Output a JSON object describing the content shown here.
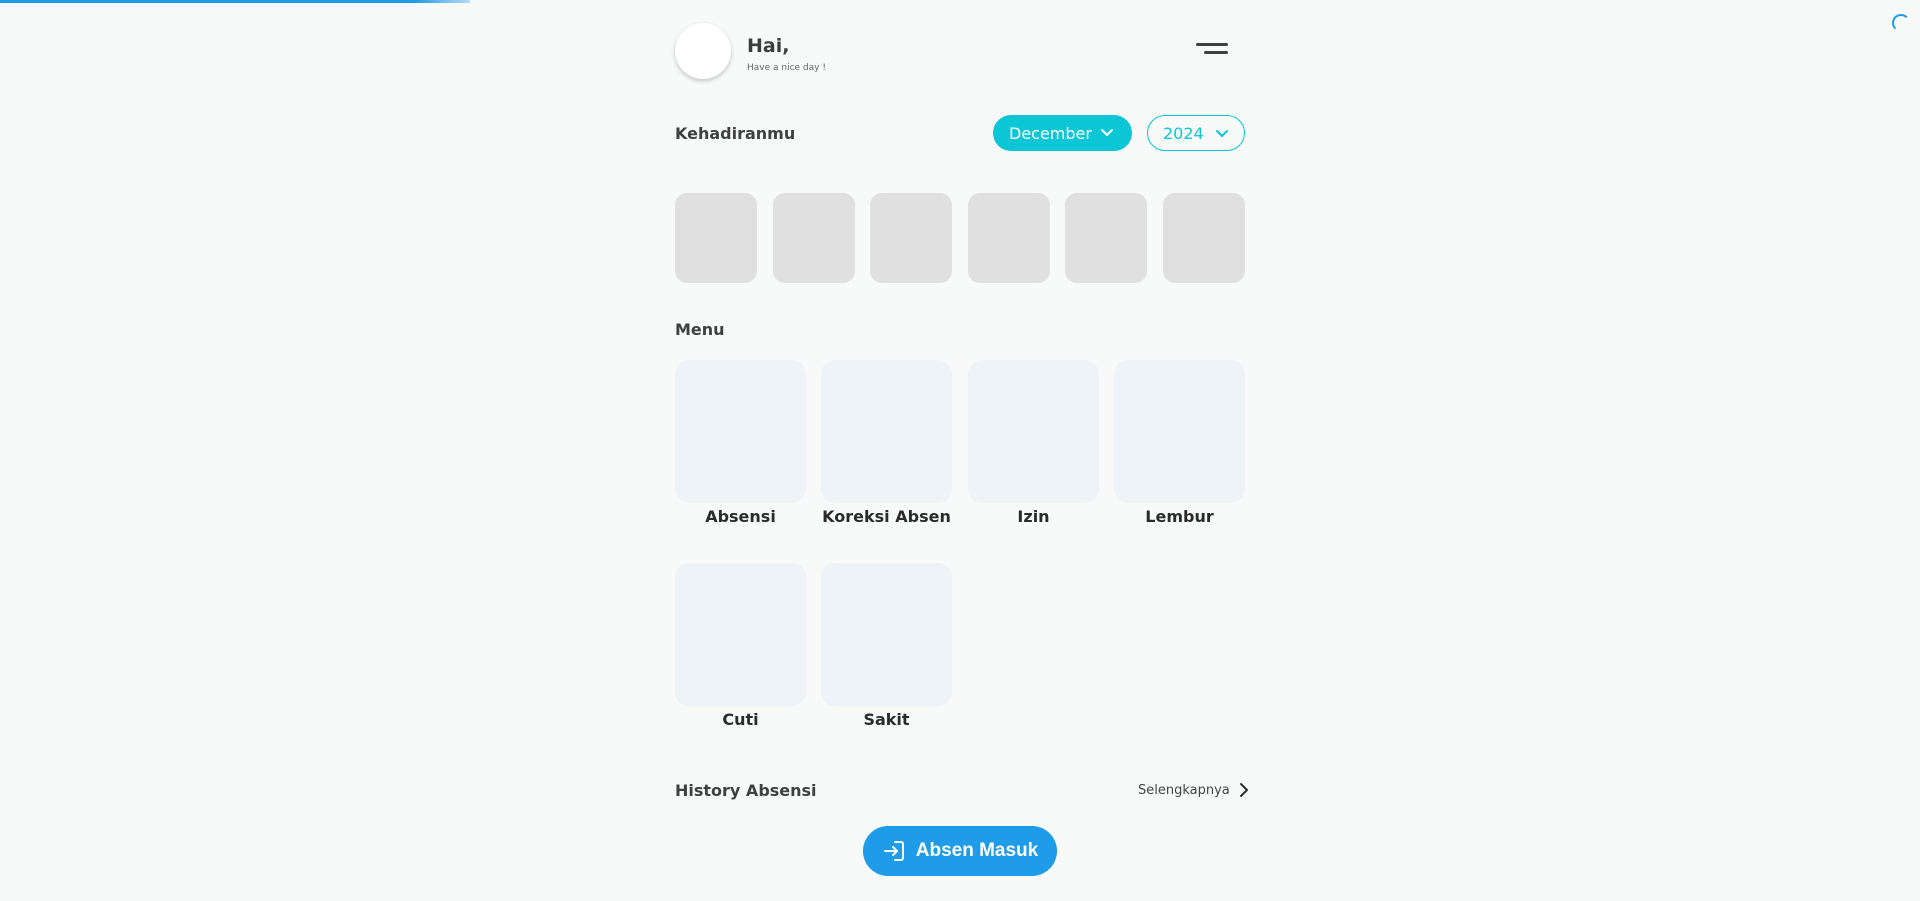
{
  "colors": {
    "accent_cyan": "#0bc6d4",
    "primary_blue": "#1e9be9",
    "skeleton_gray": "#e0e0e0",
    "card_bg": "#eef3f7"
  },
  "page_loading_progress": 0.245,
  "header": {
    "greeting": "Hai,",
    "subgreeting": "Have a nice day !",
    "menu_icon": "hamburger-icon"
  },
  "attendance": {
    "title": "Kehadiranmu",
    "month": "December",
    "year": "2024",
    "skeleton_cards": 6
  },
  "menu": {
    "title": "Menu",
    "items": [
      {
        "label": "Absensi"
      },
      {
        "label": "Koreksi Absen"
      },
      {
        "label": "Izin"
      },
      {
        "label": "Lembur"
      },
      {
        "label": "Cuti"
      },
      {
        "label": "Sakit"
      }
    ]
  },
  "history": {
    "title": "History Absensi",
    "see_more": "Selengkapnya"
  },
  "action_button": {
    "label": "Absen Masuk",
    "icon": "login-icon"
  }
}
